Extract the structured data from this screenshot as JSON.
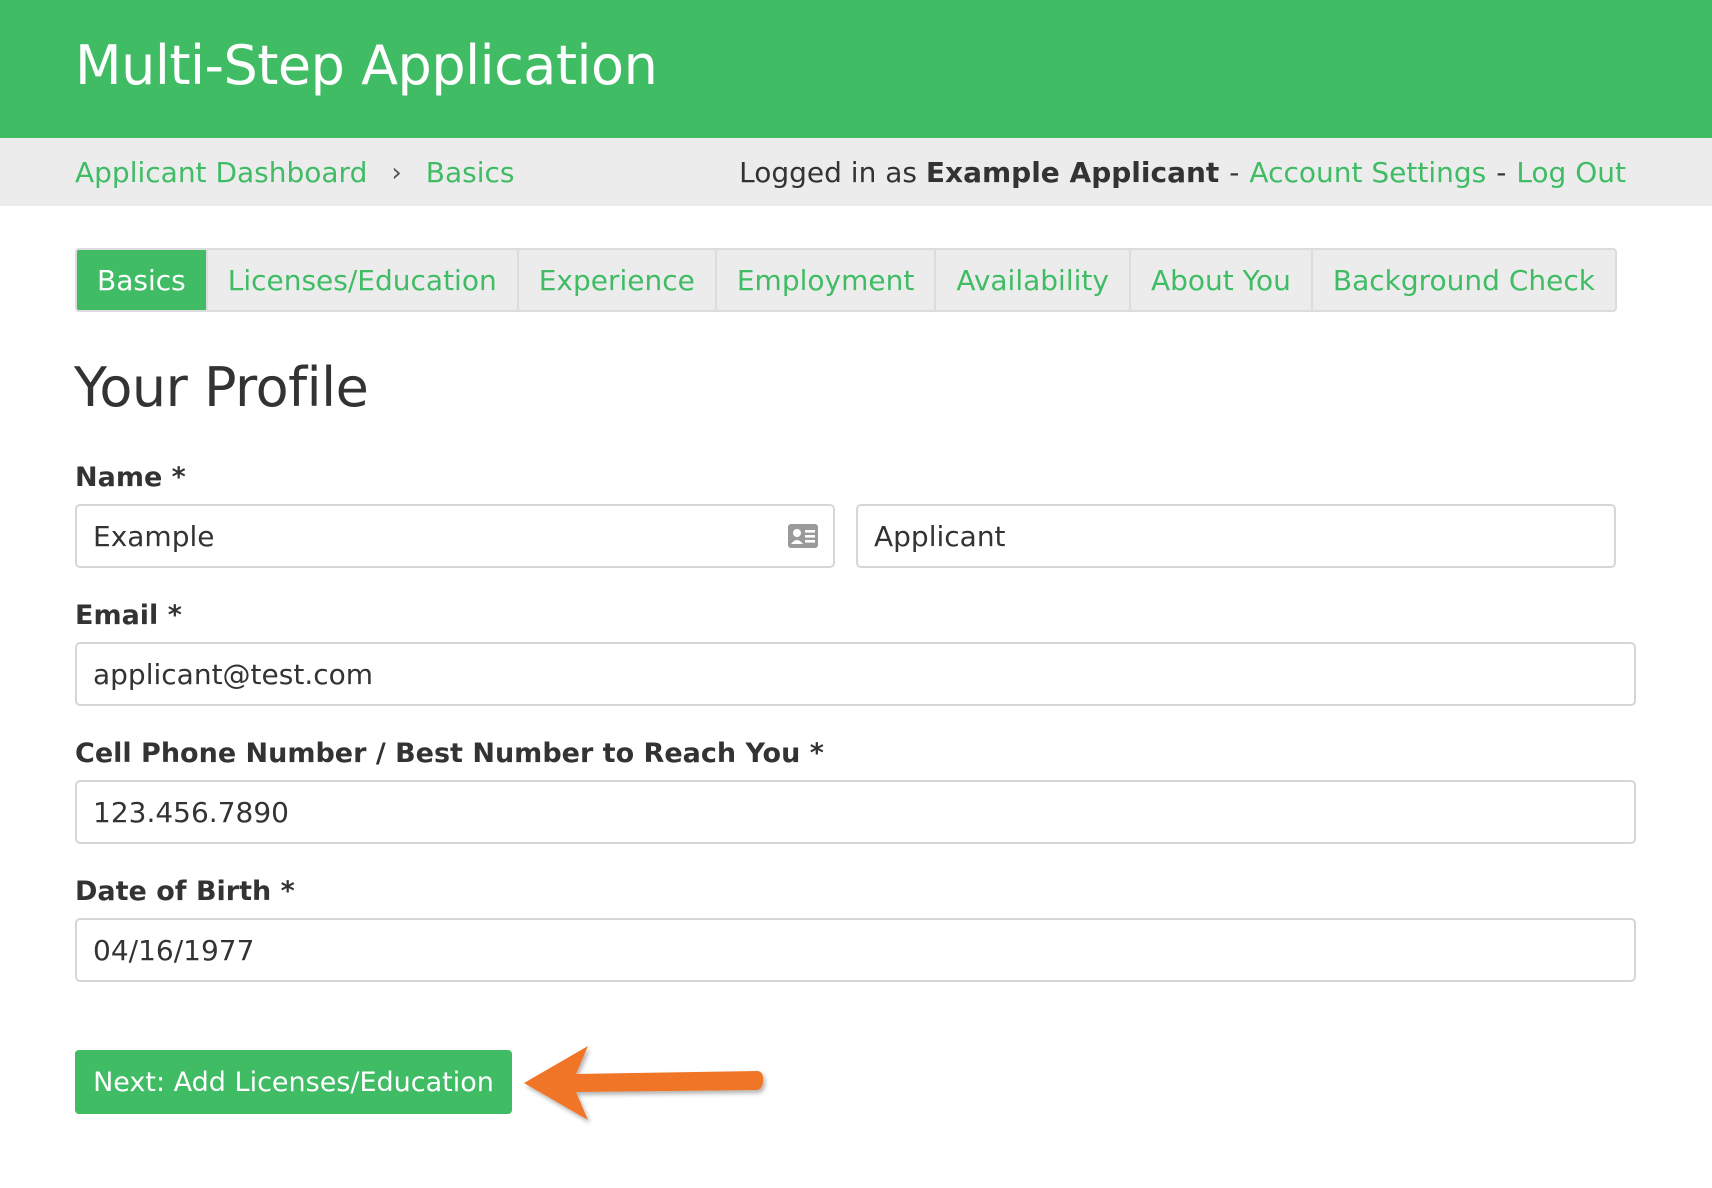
{
  "header": {
    "title": "Multi-Step Application"
  },
  "breadcrumb": {
    "dashboard": "Applicant Dashboard",
    "separator": "›",
    "current": "Basics"
  },
  "account": {
    "prefix": "Logged in as",
    "user": "Example Applicant",
    "dash": "-",
    "settings": "Account Settings",
    "logout": "Log Out"
  },
  "tabs": [
    {
      "label": "Basics",
      "active": true
    },
    {
      "label": "Licenses/Education"
    },
    {
      "label": "Experience"
    },
    {
      "label": "Employment"
    },
    {
      "label": "Availability"
    },
    {
      "label": "About You"
    },
    {
      "label": "Background Check"
    }
  ],
  "page": {
    "title": "Your Profile"
  },
  "form": {
    "name": {
      "label": "Name *",
      "first": "Example",
      "last": "Applicant",
      "icon": "contact-card-icon"
    },
    "email": {
      "label": "Email *",
      "value": "applicant@test.com"
    },
    "phone": {
      "label": "Cell Phone Number / Best Number to Reach You *",
      "value": "123.456.7890"
    },
    "dob": {
      "label": "Date of Birth *",
      "value": "04/16/1977"
    }
  },
  "actions": {
    "next_label": "Next: Add Licenses/Education"
  },
  "annotation": {
    "icon": "orange-arrow-icon",
    "color": "#f07427"
  },
  "colors": {
    "brand": "#40bc65",
    "subbar": "#ececec",
    "arrow": "#f07427"
  }
}
